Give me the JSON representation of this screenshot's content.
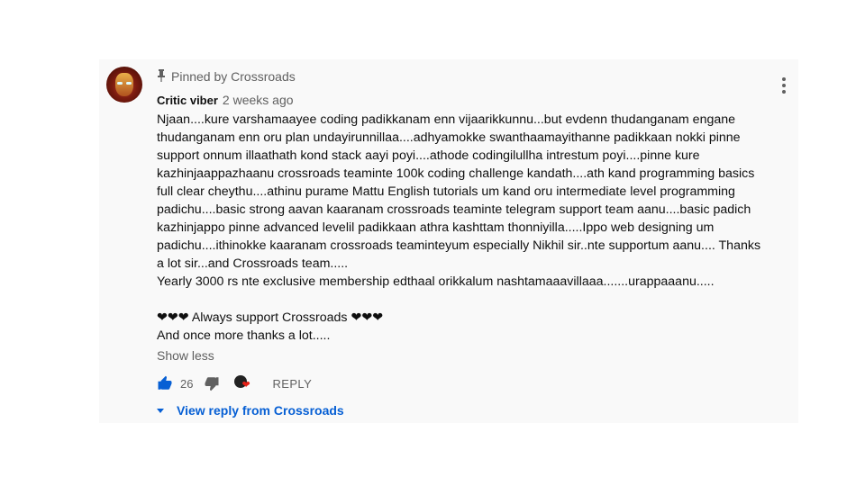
{
  "comment": {
    "pinned_label": "Pinned by Crossroads",
    "author": "Critic viber",
    "timestamp": "2 weeks ago",
    "body_paragraphs": [
      "Njaan....kure varshamaayee coding padikkanam enn vijaarikkunnu...but evdenn thudanganam engane",
      "thudanganam enn oru plan undayirunnillaa....adhyamokke swanthaamayithanne padikkaan nokki pinne",
      "support onnum illaathath kond stack aayi poyi....athode codingilullha intrestum poyi....pinne kure",
      "kazhinjaappazhaanu crossroads teaminte 100k coding challenge kandath....ath kand programming basics",
      "full clear cheythu....athinu purame Mattu English tutorials um kand oru intermediate level programming",
      "padichu....basic strong aavan kaaranam crossroads teaminte telegram support team aanu....basic padich",
      "kazhinjappo pinne advanced levelil padikkaan athra kashttam thonniyilla.....Ippo web designing um",
      "padichu....ithinokke kaaranam crossroads teaminteyum especially Nikhil sir..nte supportum aanu.... Thanks",
      "a lot sir...and Crossroads team.....",
      "Yearly 3000 rs nte exclusive membership edthaal orikkalum nashtamaaavillaaa.......urappaaanu....."
    ],
    "hearts_left": "❤❤❤",
    "support_line": " Always support Crossroads ",
    "hearts_right": "❤❤❤",
    "closing_line": "And once more thanks a lot.....",
    "show_less_label": "Show less",
    "like_count": "26",
    "reply_label": "REPLY",
    "view_reply_label": "View reply from Crossroads"
  },
  "icons": {
    "pin": "pin-icon",
    "like": "thumbs-up-icon",
    "dislike": "thumbs-down-icon",
    "creator_heart": "creator-heart-icon",
    "menu": "more-vert-icon",
    "expand": "caret-down-icon"
  },
  "colors": {
    "card_bg": "#f9f9f9",
    "link_blue": "#065fd4",
    "like_blue": "#065fd4",
    "muted_text": "#606060",
    "heart_red": "#e62117"
  }
}
